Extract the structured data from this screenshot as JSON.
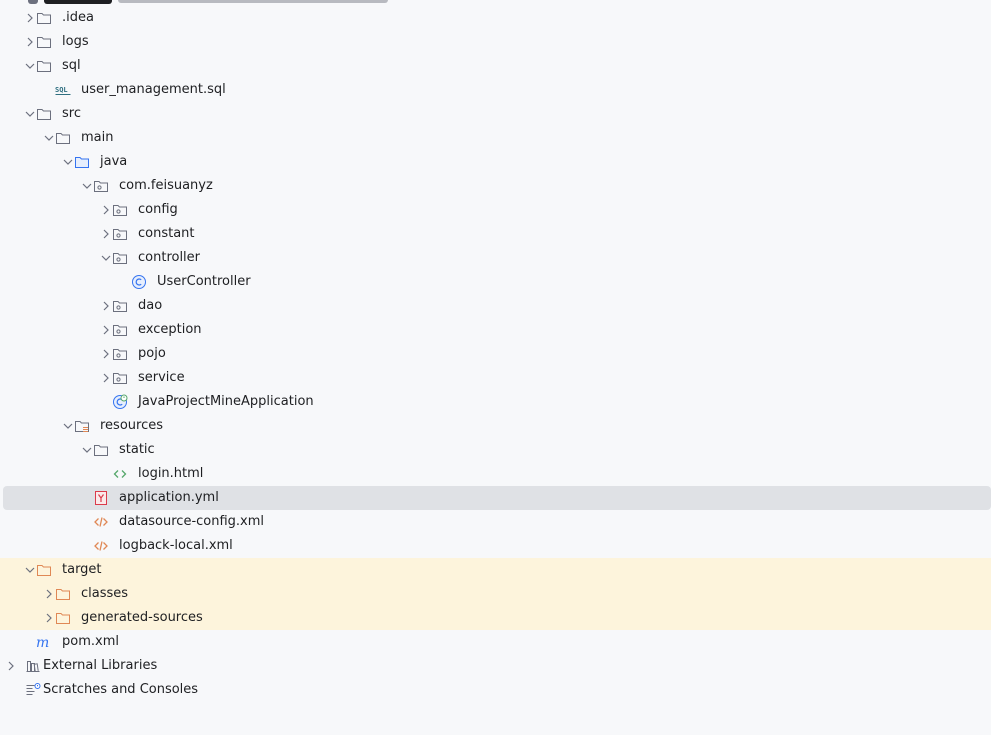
{
  "tree": [
    {
      "label": ".idea",
      "depth": 1,
      "expanded": false,
      "icon": "folder-icon",
      "chevron": true
    },
    {
      "label": "logs",
      "depth": 1,
      "expanded": false,
      "icon": "folder-icon",
      "chevron": true
    },
    {
      "label": "sql",
      "depth": 1,
      "expanded": true,
      "icon": "folder-icon",
      "chevron": true
    },
    {
      "label": "user_management.sql",
      "depth": 2,
      "icon": "sql-file-icon",
      "chevron": false
    },
    {
      "label": "src",
      "depth": 1,
      "expanded": true,
      "icon": "folder-icon",
      "chevron": true
    },
    {
      "label": "main",
      "depth": 2,
      "expanded": true,
      "icon": "folder-icon",
      "chevron": true
    },
    {
      "label": "java",
      "depth": 3,
      "expanded": true,
      "icon": "source-folder-icon",
      "chevron": true
    },
    {
      "label": "com.feisuanyz",
      "depth": 4,
      "expanded": true,
      "icon": "package-icon",
      "chevron": true
    },
    {
      "label": "config",
      "depth": 5,
      "expanded": false,
      "icon": "package-icon",
      "chevron": true
    },
    {
      "label": "constant",
      "depth": 5,
      "expanded": false,
      "icon": "package-icon",
      "chevron": true
    },
    {
      "label": "controller",
      "depth": 5,
      "expanded": true,
      "icon": "package-icon",
      "chevron": true
    },
    {
      "label": "UserController",
      "depth": 6,
      "icon": "class-icon",
      "chevron": false
    },
    {
      "label": "dao",
      "depth": 5,
      "expanded": false,
      "icon": "package-icon",
      "chevron": true
    },
    {
      "label": "exception",
      "depth": 5,
      "expanded": false,
      "icon": "package-icon",
      "chevron": true
    },
    {
      "label": "pojo",
      "depth": 5,
      "expanded": false,
      "icon": "package-icon",
      "chevron": true
    },
    {
      "label": "service",
      "depth": 5,
      "expanded": false,
      "icon": "package-icon",
      "chevron": true
    },
    {
      "label": "JavaProjectMineApplication",
      "depth": 5,
      "icon": "spring-app-icon",
      "chevron": false
    },
    {
      "label": "resources",
      "depth": 3,
      "expanded": true,
      "icon": "resources-folder-icon",
      "chevron": true
    },
    {
      "label": "static",
      "depth": 4,
      "expanded": true,
      "icon": "folder-icon",
      "chevron": true
    },
    {
      "label": "login.html",
      "depth": 5,
      "icon": "html-file-icon",
      "chevron": false
    },
    {
      "label": "application.yml",
      "depth": 4,
      "icon": "yaml-file-icon",
      "chevron": false,
      "selected": true
    },
    {
      "label": "datasource-config.xml",
      "depth": 4,
      "icon": "xml-file-icon",
      "chevron": false
    },
    {
      "label": "logback-local.xml",
      "depth": 4,
      "icon": "xml-file-icon",
      "chevron": false
    },
    {
      "label": "target",
      "depth": 1,
      "expanded": true,
      "icon": "excluded-folder-icon",
      "chevron": true,
      "excluded": true
    },
    {
      "label": "classes",
      "depth": 2,
      "expanded": false,
      "icon": "excluded-folder-icon",
      "chevron": true,
      "excluded": true
    },
    {
      "label": "generated-sources",
      "depth": 2,
      "expanded": false,
      "icon": "excluded-folder-icon",
      "chevron": true,
      "excluded": true
    },
    {
      "label": "pom.xml",
      "depth": 1,
      "icon": "maven-icon",
      "chevron": false
    },
    {
      "label": "External Libraries",
      "depth": 0,
      "expanded": false,
      "icon": "libraries-icon",
      "chevron": true
    },
    {
      "label": "Scratches and Consoles",
      "depth": 0,
      "icon": "scratches-icon",
      "chevron": false
    }
  ],
  "colors": {
    "background": "#f7f8fa",
    "selection": "#dfe1e5",
    "excluded_background": "#fdf4dc",
    "folder_stroke": "#6c707e",
    "source_folder_stroke": "#3574f0",
    "excluded_folder_stroke": "#e08855",
    "class_icon": "#3574f0",
    "html_icon": "#55a76a",
    "xml_icon": "#e08855",
    "yaml_icon": "#db3b4b",
    "maven_icon": "#3574f0"
  }
}
